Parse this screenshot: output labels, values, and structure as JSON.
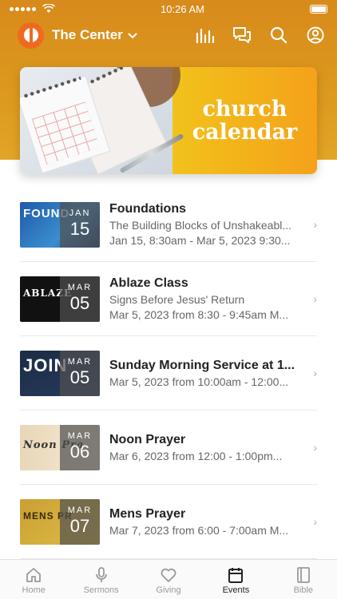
{
  "status_bar": {
    "time": "10:26 AM"
  },
  "header": {
    "title": "The Center"
  },
  "banner": {
    "line1": "church",
    "line2": "calendar"
  },
  "events": [
    {
      "title": "Foundations",
      "subtitle": "The Building Blocks of Unshakeabl...",
      "date_line": "Jan 15, 8:30am - Mar 5, 2023 9:30...",
      "badge_month": "JAN",
      "badge_day": "15",
      "thumb_text": "FOUND"
    },
    {
      "title": "Ablaze Class",
      "subtitle": "Signs Before Jesus' Return",
      "date_line": "Mar 5, 2023 from 8:30 - 9:45am M...",
      "badge_month": "MAR",
      "badge_day": "05",
      "thumb_text": "ABLAZE"
    },
    {
      "title": "Sunday Morning Service at 1...",
      "subtitle": "",
      "date_line": "Mar 5, 2023 from 10:00am - 12:00...",
      "badge_month": "MAR",
      "badge_day": "05",
      "thumb_text": "JOIN"
    },
    {
      "title": "Noon Prayer",
      "subtitle": "",
      "date_line": "Mar 6, 2023 from 12:00 - 1:00pm...",
      "badge_month": "MAR",
      "badge_day": "06",
      "thumb_text": "Noon Pra"
    },
    {
      "title": "Mens Prayer",
      "subtitle": "",
      "date_line": "Mar 7, 2023 from 6:00 - 7:00am M...",
      "badge_month": "MAR",
      "badge_day": "07",
      "thumb_text": "MENS PR"
    }
  ],
  "tabs": [
    {
      "label": "Home",
      "icon": "home-icon"
    },
    {
      "label": "Sermons",
      "icon": "microphone-icon"
    },
    {
      "label": "Giving",
      "icon": "heart-icon"
    },
    {
      "label": "Events",
      "icon": "calendar-icon"
    },
    {
      "label": "Bible",
      "icon": "book-icon"
    }
  ],
  "colors": {
    "header": "#dc9a1e",
    "logo": "#ef6a1f",
    "banner_gold": "#f1c21b"
  }
}
